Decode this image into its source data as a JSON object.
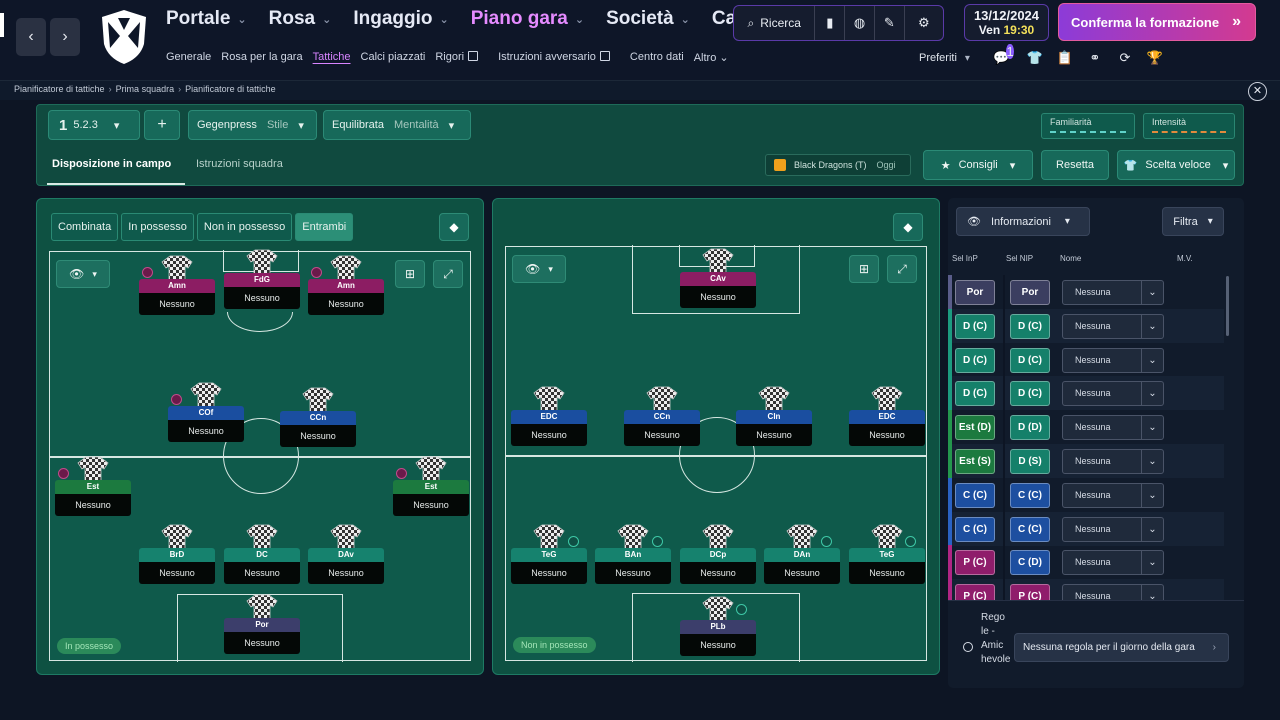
{
  "nav": {
    "main": [
      {
        "label": "Portale",
        "active": false
      },
      {
        "label": "Rosa",
        "active": false
      },
      {
        "label": "Ingaggio",
        "active": false
      },
      {
        "label": "Piano gara",
        "active": true
      },
      {
        "label": "Società",
        "active": false
      },
      {
        "label": "Carriera",
        "active": false
      }
    ],
    "sub": [
      "Generale",
      "Rosa per la gara",
      "Tattiche",
      "Calci piazzati",
      "Rigori",
      "Istruzioni avversario",
      "Centro dati",
      "Altro"
    ],
    "sub_active": "Tattiche",
    "search_label": "Ricerca",
    "date": "13/12/2024",
    "day": "Ven",
    "time": "19:30",
    "confirm_label": "Conferma la formazione",
    "favorites_label": "Preferiti",
    "notification_count": "1"
  },
  "breadcrumb": [
    "Pianificatore di tattiche",
    "Prima squadra",
    "Pianificatore di tattiche"
  ],
  "toolbar": {
    "tactic_number": "1",
    "formation": "5.2.3",
    "add_label": "+",
    "style_value": "Gegenpress",
    "style_label": "Stile",
    "mentality_value": "Equilibrata",
    "mentality_label": "Mentalità",
    "familiarity_label": "Familiarità",
    "intensity_label": "Intensità",
    "tabs": [
      "Disposizione in campo",
      "Istruzioni squadra"
    ],
    "opponent_name": "Black Dragons (T)",
    "opponent_when": "Oggi",
    "advice_label": "Consigli",
    "reset_label": "Resetta",
    "quick_label": "Scelta veloce"
  },
  "phase_tabs": [
    "Combinata",
    "In possesso",
    "Non in possesso",
    "Entrambi"
  ],
  "phase_active": "Entrambi",
  "in_possession": {
    "label": "In possesso",
    "players": [
      {
        "role": "Amn",
        "name": "Nessuno",
        "cls": "r-att"
      },
      {
        "role": "FdG",
        "name": "Nessuno",
        "cls": "r-att"
      },
      {
        "role": "Amn",
        "name": "Nessuno",
        "cls": "r-att"
      },
      {
        "role": "COf",
        "name": "Nessuno",
        "cls": "r-mid"
      },
      {
        "role": "CCn",
        "name": "Nessuno",
        "cls": "r-mid"
      },
      {
        "role": "Est",
        "name": "Nessuno",
        "cls": "r-wide"
      },
      {
        "role": "Est",
        "name": "Nessuno",
        "cls": "r-wide"
      },
      {
        "role": "BrD",
        "name": "Nessuno",
        "cls": "r-def"
      },
      {
        "role": "DC",
        "name": "Nessuno",
        "cls": "r-def"
      },
      {
        "role": "DAv",
        "name": "Nessuno",
        "cls": "r-def"
      },
      {
        "role": "Por",
        "name": "Nessuno",
        "cls": "r-gk"
      }
    ]
  },
  "out_possession": {
    "label": "Non in possesso",
    "players": [
      {
        "role": "CAv",
        "name": "Nessuno",
        "cls": "r-att"
      },
      {
        "role": "EDC",
        "name": "Nessuno",
        "cls": "r-mid"
      },
      {
        "role": "CCn",
        "name": "Nessuno",
        "cls": "r-mid"
      },
      {
        "role": "CIn",
        "name": "Nessuno",
        "cls": "r-mid"
      },
      {
        "role": "EDC",
        "name": "Nessuno",
        "cls": "r-mid"
      },
      {
        "role": "TeG",
        "name": "Nessuno",
        "cls": "r-def"
      },
      {
        "role": "BAn",
        "name": "Nessuno",
        "cls": "r-def"
      },
      {
        "role": "DCp",
        "name": "Nessuno",
        "cls": "r-def"
      },
      {
        "role": "DAn",
        "name": "Nessuno",
        "cls": "r-def"
      },
      {
        "role": "TeG",
        "name": "Nessuno",
        "cls": "r-def"
      },
      {
        "role": "PLb",
        "name": "Nessuno",
        "cls": "r-gk"
      }
    ]
  },
  "info_panel": {
    "info_label": "Informazioni",
    "filter_label": "Filtra",
    "headers": [
      "Sel InP",
      "Sel NIP",
      "Nome",
      "M.V."
    ],
    "rows": [
      {
        "inp": "Por",
        "nip": "Por",
        "name": "Nessuna",
        "ic": "p-gk",
        "nc": "p-gk"
      },
      {
        "inp": "D (C)",
        "nip": "D (C)",
        "name": "Nessuna",
        "ic": "p-def",
        "nc": "p-def"
      },
      {
        "inp": "D (C)",
        "nip": "D (C)",
        "name": "Nessuna",
        "ic": "p-def",
        "nc": "p-def"
      },
      {
        "inp": "D (C)",
        "nip": "D (C)",
        "name": "Nessuna",
        "ic": "p-def",
        "nc": "p-def"
      },
      {
        "inp": "Est (D)",
        "nip": "D (D)",
        "name": "Nessuna",
        "ic": "p-wid",
        "nc": "p-def"
      },
      {
        "inp": "Est (S)",
        "nip": "D (S)",
        "name": "Nessuna",
        "ic": "p-wid",
        "nc": "p-def"
      },
      {
        "inp": "C (C)",
        "nip": "C (C)",
        "name": "Nessuna",
        "ic": "p-mid",
        "nc": "p-mid"
      },
      {
        "inp": "C (C)",
        "nip": "C (C)",
        "name": "Nessuna",
        "ic": "p-mid",
        "nc": "p-mid"
      },
      {
        "inp": "P (C)",
        "nip": "C (D)",
        "name": "Nessuna",
        "ic": "p-att",
        "nc": "p-mid"
      },
      {
        "inp": "P (C)",
        "nip": "P (C)",
        "name": "Nessuna",
        "ic": "p-att",
        "nc": "p-att"
      }
    ],
    "rules_label": "Rego le - Amic hevole",
    "rules_value": "Nessuna regola per il giorno della gara"
  }
}
